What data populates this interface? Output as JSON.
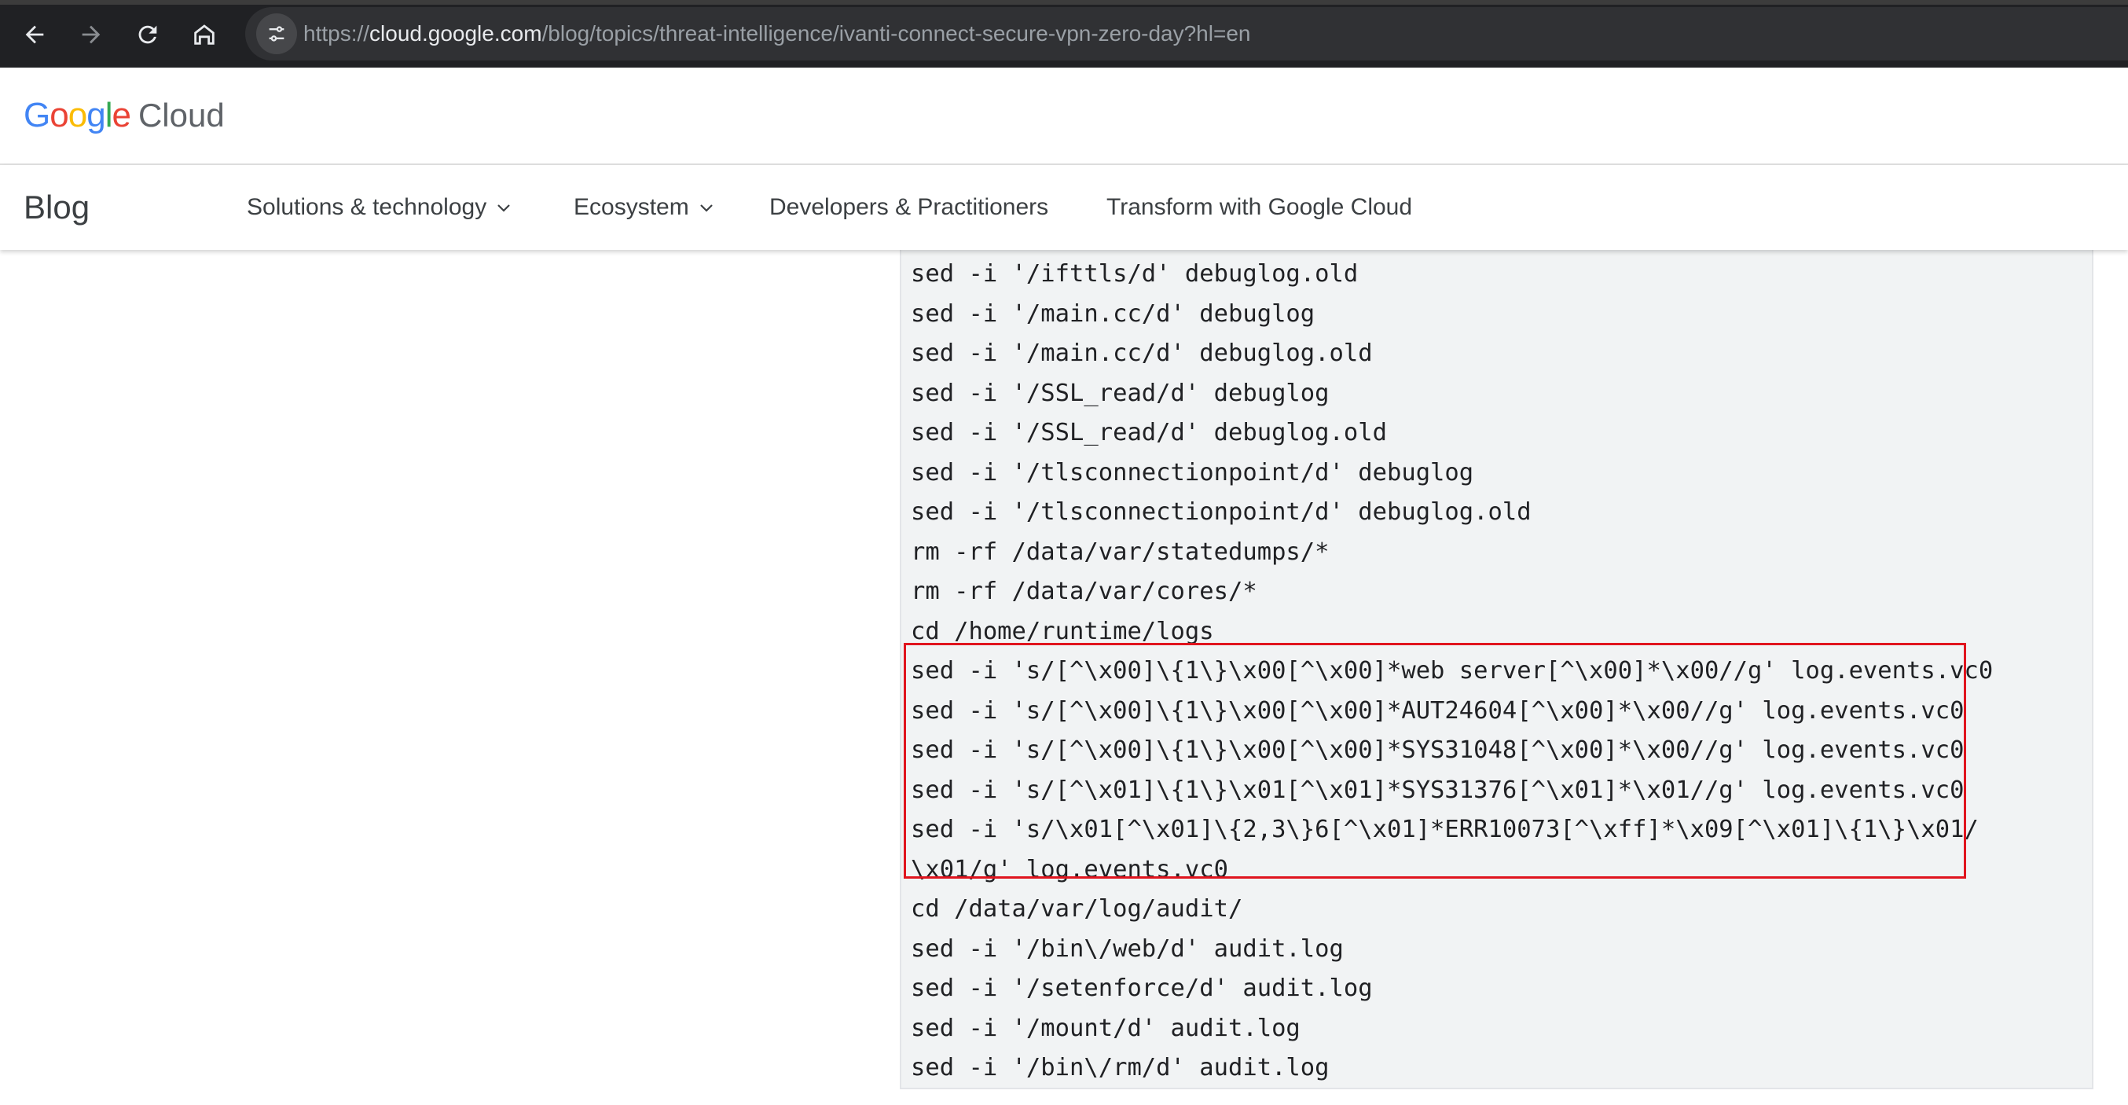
{
  "browser": {
    "url_scheme": "https://",
    "url_host": "cloud.google.com",
    "url_path": "/blog/topics/threat-intelligence/ivanti-connect-secure-vpn-zero-day?hl=en",
    "icons": [
      "back-icon",
      "forward-icon",
      "reload-icon",
      "home-icon",
      "site-settings-icon"
    ]
  },
  "header": {
    "logo_letters": [
      "G",
      "o",
      "o",
      "g",
      "l",
      "e"
    ],
    "logo_colors": [
      "#4285F4",
      "#EA4335",
      "#FBBC05",
      "#4285F4",
      "#34A853",
      "#EA4335"
    ],
    "logo_suffix": "Cloud"
  },
  "blog_nav": {
    "title": "Blog",
    "items": [
      {
        "label": "Solutions & technology",
        "has_dropdown": true
      },
      {
        "label": "Ecosystem",
        "has_dropdown": true
      },
      {
        "label": "Developers & Practitioners",
        "has_dropdown": false
      },
      {
        "label": "Transform with Google Cloud",
        "has_dropdown": false
      }
    ]
  },
  "code": {
    "lines": [
      "sed -i '/ifttls/d' debuglog.old",
      "sed -i '/main.cc/d' debuglog",
      "sed -i '/main.cc/d' debuglog.old",
      "sed -i '/SSL_read/d' debuglog",
      "sed -i '/SSL_read/d' debuglog.old",
      "sed -i '/tlsconnectionpoint/d' debuglog",
      "sed -i '/tlsconnectionpoint/d' debuglog.old",
      "rm -rf /data/var/statedumps/*",
      "rm -rf /data/var/cores/*",
      "cd /home/runtime/logs",
      "sed -i 's/[^\\x00]\\{1\\}\\x00[^\\x00]*web server[^\\x00]*\\x00//g' log.events.vc0",
      "sed -i 's/[^\\x00]\\{1\\}\\x00[^\\x00]*AUT24604[^\\x00]*\\x00//g' log.events.vc0",
      "sed -i 's/[^\\x00]\\{1\\}\\x00[^\\x00]*SYS31048[^\\x00]*\\x00//g' log.events.vc0",
      "sed -i 's/[^\\x01]\\{1\\}\\x01[^\\x01]*SYS31376[^\\x01]*\\x01//g' log.events.vc0",
      "sed -i 's/\\x01[^\\x01]\\{2,3\\}6[^\\x01]*ERR10073[^\\xff]*\\x09[^\\x01]\\{1\\}\\x01/",
      "\\x01/g' log.events.vc0",
      "cd /data/var/log/audit/",
      "sed -i '/bin\\/web/d' audit.log",
      "sed -i '/setenforce/d' audit.log",
      "sed -i '/mount/d' audit.log",
      "sed -i '/bin\\/rm/d' audit.log"
    ],
    "highlight_color": "#e0141e"
  }
}
